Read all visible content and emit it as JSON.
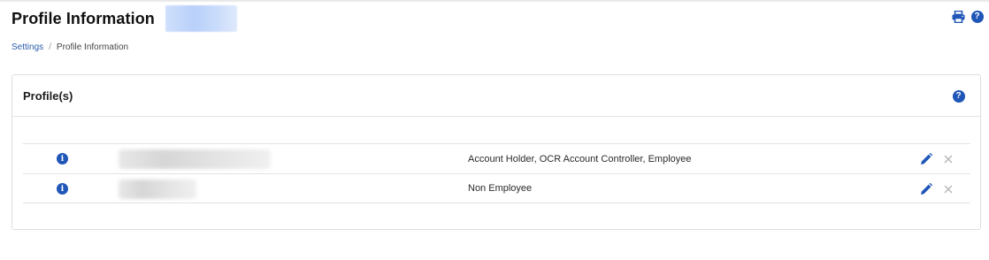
{
  "header": {
    "title": "Profile Information",
    "print_icon": "printer-icon",
    "help_icon": "help-circle-icon",
    "help_glyph": "?"
  },
  "breadcrumb": {
    "items": [
      {
        "label": "Settings"
      },
      {
        "label": "Profile Information"
      }
    ],
    "separator": "/"
  },
  "card": {
    "title": "Profile(s)",
    "help_glyph": "?"
  },
  "profiles": [
    {
      "info_glyph": "i",
      "roles": "Account Holder, OCR Account Controller, Employee",
      "edit_icon": "pencil-icon",
      "delete_icon": "close-icon"
    },
    {
      "info_glyph": "i",
      "roles": "Non Employee",
      "edit_icon": "pencil-icon",
      "delete_icon": "close-icon"
    }
  ],
  "colors": {
    "accent": "#1f56b8",
    "link": "#2b5cab",
    "border": "#dedede",
    "muted_icon": "#b7b7b7"
  }
}
